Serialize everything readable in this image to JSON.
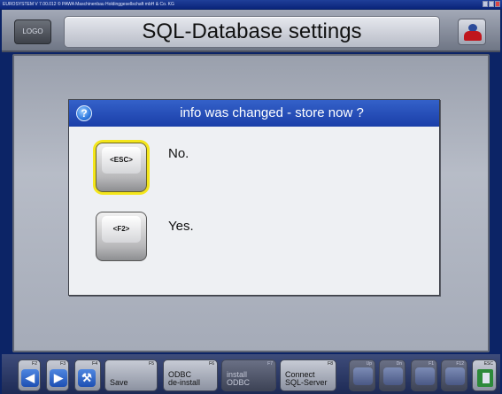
{
  "window": {
    "titlebar_text": "EUROSYSTEM V 7.00.012 © PAWA Maschinenbau Holdinggesellschaft mbH & Co. KG"
  },
  "header": {
    "logo_label": "LOGO",
    "title": "SQL-Database settings"
  },
  "dialog": {
    "help_symbol": "?",
    "title": "info was changed - store now ?",
    "options": [
      {
        "key": "<ESC>",
        "label": "No.",
        "selected": true
      },
      {
        "key": "<F2>",
        "label": "Yes.",
        "selected": false
      }
    ]
  },
  "footer": {
    "buttons": [
      {
        "fkey": "F2",
        "label": "",
        "icon": "arrow-left-icon",
        "glyph": "◀"
      },
      {
        "fkey": "F3",
        "label": "",
        "icon": "arrow-right-icon",
        "glyph": "▶"
      },
      {
        "fkey": "F4",
        "label": "",
        "icon": "wrench-icon",
        "glyph": "⚒"
      },
      {
        "fkey": "F5",
        "label": "Save",
        "icon": ""
      },
      {
        "fkey": "F6",
        "label": "ODBC\nde-install",
        "icon": ""
      },
      {
        "fkey": "F7",
        "label": "install\nODBC",
        "icon": "",
        "disabled": true
      },
      {
        "fkey": "F8",
        "label": "Connect\nSQL-Server",
        "icon": ""
      },
      {
        "fkey": "Up",
        "label": "",
        "icon": "arrow-up-icon",
        "disabled": true
      },
      {
        "fkey": "Dn",
        "label": "",
        "icon": "arrow-down-icon",
        "disabled": true
      },
      {
        "fkey": "F1",
        "label": "",
        "icon": "help-icon",
        "disabled": true
      },
      {
        "fkey": "F12",
        "label": "",
        "icon": "print-icon",
        "disabled": true
      },
      {
        "fkey": "ESC",
        "label": "",
        "icon": "exit-icon"
      }
    ]
  },
  "colors": {
    "dialog_header": "#2a52be",
    "selection_highlight": "#f4e61b",
    "background": "#0c2466"
  }
}
